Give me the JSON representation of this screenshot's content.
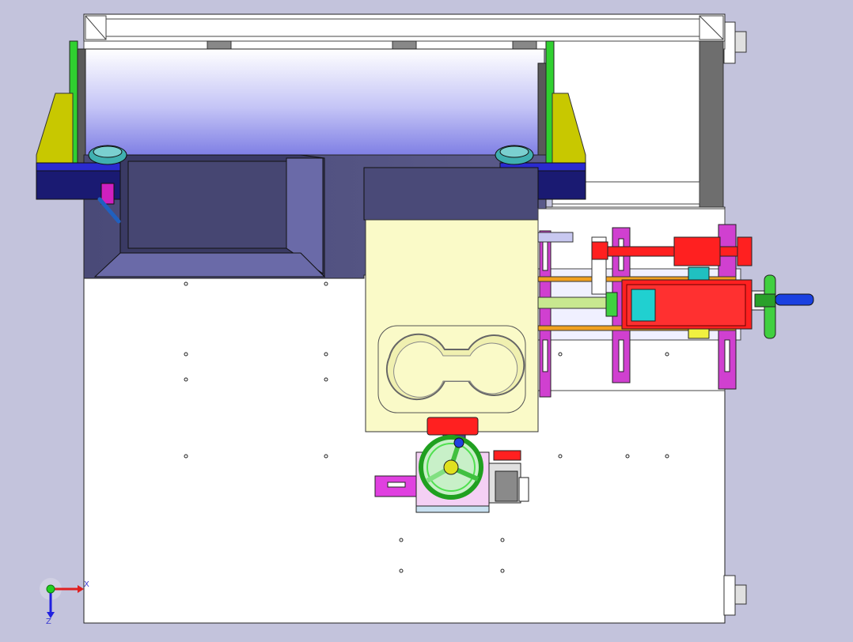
{
  "viewport": {
    "background_color": "#c3c3dc",
    "view": "top"
  },
  "triad": {
    "x_label": "X",
    "z_label": "Z",
    "x_color": "#e02020",
    "z_color": "#2020e0",
    "origin_color": "#20d020"
  },
  "colors": {
    "base_plate": "#ffffff",
    "roller": "#b8b8f0",
    "hopper": "#4c4c78",
    "yellow_block": "#fafac8",
    "red_parts": "#ff1a1a",
    "magenta_parts": "#e040e0",
    "green_handwheel": "#40e040",
    "olive_brackets": "#c8c800",
    "blue_blocks": "#1a1a70",
    "orange_rods": "#f0a020"
  }
}
